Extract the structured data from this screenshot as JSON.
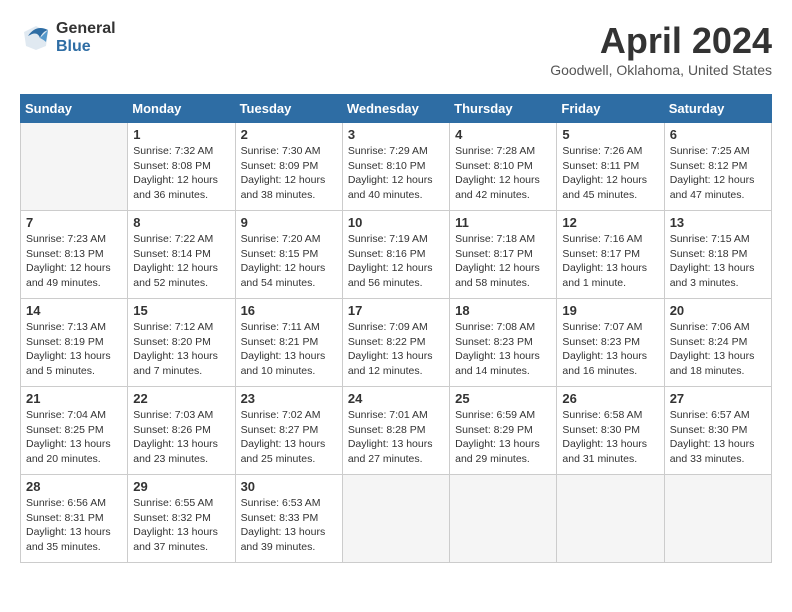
{
  "header": {
    "logo_line1": "General",
    "logo_line2": "Blue",
    "month": "April 2024",
    "location": "Goodwell, Oklahoma, United States"
  },
  "days_of_week": [
    "Sunday",
    "Monday",
    "Tuesday",
    "Wednesday",
    "Thursday",
    "Friday",
    "Saturday"
  ],
  "weeks": [
    [
      {
        "day": "",
        "info": ""
      },
      {
        "day": "1",
        "info": "Sunrise: 7:32 AM\nSunset: 8:08 PM\nDaylight: 12 hours\nand 36 minutes."
      },
      {
        "day": "2",
        "info": "Sunrise: 7:30 AM\nSunset: 8:09 PM\nDaylight: 12 hours\nand 38 minutes."
      },
      {
        "day": "3",
        "info": "Sunrise: 7:29 AM\nSunset: 8:10 PM\nDaylight: 12 hours\nand 40 minutes."
      },
      {
        "day": "4",
        "info": "Sunrise: 7:28 AM\nSunset: 8:10 PM\nDaylight: 12 hours\nand 42 minutes."
      },
      {
        "day": "5",
        "info": "Sunrise: 7:26 AM\nSunset: 8:11 PM\nDaylight: 12 hours\nand 45 minutes."
      },
      {
        "day": "6",
        "info": "Sunrise: 7:25 AM\nSunset: 8:12 PM\nDaylight: 12 hours\nand 47 minutes."
      }
    ],
    [
      {
        "day": "7",
        "info": "Sunrise: 7:23 AM\nSunset: 8:13 PM\nDaylight: 12 hours\nand 49 minutes."
      },
      {
        "day": "8",
        "info": "Sunrise: 7:22 AM\nSunset: 8:14 PM\nDaylight: 12 hours\nand 52 minutes."
      },
      {
        "day": "9",
        "info": "Sunrise: 7:20 AM\nSunset: 8:15 PM\nDaylight: 12 hours\nand 54 minutes."
      },
      {
        "day": "10",
        "info": "Sunrise: 7:19 AM\nSunset: 8:16 PM\nDaylight: 12 hours\nand 56 minutes."
      },
      {
        "day": "11",
        "info": "Sunrise: 7:18 AM\nSunset: 8:17 PM\nDaylight: 12 hours\nand 58 minutes."
      },
      {
        "day": "12",
        "info": "Sunrise: 7:16 AM\nSunset: 8:17 PM\nDaylight: 13 hours\nand 1 minute."
      },
      {
        "day": "13",
        "info": "Sunrise: 7:15 AM\nSunset: 8:18 PM\nDaylight: 13 hours\nand 3 minutes."
      }
    ],
    [
      {
        "day": "14",
        "info": "Sunrise: 7:13 AM\nSunset: 8:19 PM\nDaylight: 13 hours\nand 5 minutes."
      },
      {
        "day": "15",
        "info": "Sunrise: 7:12 AM\nSunset: 8:20 PM\nDaylight: 13 hours\nand 7 minutes."
      },
      {
        "day": "16",
        "info": "Sunrise: 7:11 AM\nSunset: 8:21 PM\nDaylight: 13 hours\nand 10 minutes."
      },
      {
        "day": "17",
        "info": "Sunrise: 7:09 AM\nSunset: 8:22 PM\nDaylight: 13 hours\nand 12 minutes."
      },
      {
        "day": "18",
        "info": "Sunrise: 7:08 AM\nSunset: 8:23 PM\nDaylight: 13 hours\nand 14 minutes."
      },
      {
        "day": "19",
        "info": "Sunrise: 7:07 AM\nSunset: 8:23 PM\nDaylight: 13 hours\nand 16 minutes."
      },
      {
        "day": "20",
        "info": "Sunrise: 7:06 AM\nSunset: 8:24 PM\nDaylight: 13 hours\nand 18 minutes."
      }
    ],
    [
      {
        "day": "21",
        "info": "Sunrise: 7:04 AM\nSunset: 8:25 PM\nDaylight: 13 hours\nand 20 minutes."
      },
      {
        "day": "22",
        "info": "Sunrise: 7:03 AM\nSunset: 8:26 PM\nDaylight: 13 hours\nand 23 minutes."
      },
      {
        "day": "23",
        "info": "Sunrise: 7:02 AM\nSunset: 8:27 PM\nDaylight: 13 hours\nand 25 minutes."
      },
      {
        "day": "24",
        "info": "Sunrise: 7:01 AM\nSunset: 8:28 PM\nDaylight: 13 hours\nand 27 minutes."
      },
      {
        "day": "25",
        "info": "Sunrise: 6:59 AM\nSunset: 8:29 PM\nDaylight: 13 hours\nand 29 minutes."
      },
      {
        "day": "26",
        "info": "Sunrise: 6:58 AM\nSunset: 8:30 PM\nDaylight: 13 hours\nand 31 minutes."
      },
      {
        "day": "27",
        "info": "Sunrise: 6:57 AM\nSunset: 8:30 PM\nDaylight: 13 hours\nand 33 minutes."
      }
    ],
    [
      {
        "day": "28",
        "info": "Sunrise: 6:56 AM\nSunset: 8:31 PM\nDaylight: 13 hours\nand 35 minutes."
      },
      {
        "day": "29",
        "info": "Sunrise: 6:55 AM\nSunset: 8:32 PM\nDaylight: 13 hours\nand 37 minutes."
      },
      {
        "day": "30",
        "info": "Sunrise: 6:53 AM\nSunset: 8:33 PM\nDaylight: 13 hours\nand 39 minutes."
      },
      {
        "day": "",
        "info": ""
      },
      {
        "day": "",
        "info": ""
      },
      {
        "day": "",
        "info": ""
      },
      {
        "day": "",
        "info": ""
      }
    ]
  ]
}
